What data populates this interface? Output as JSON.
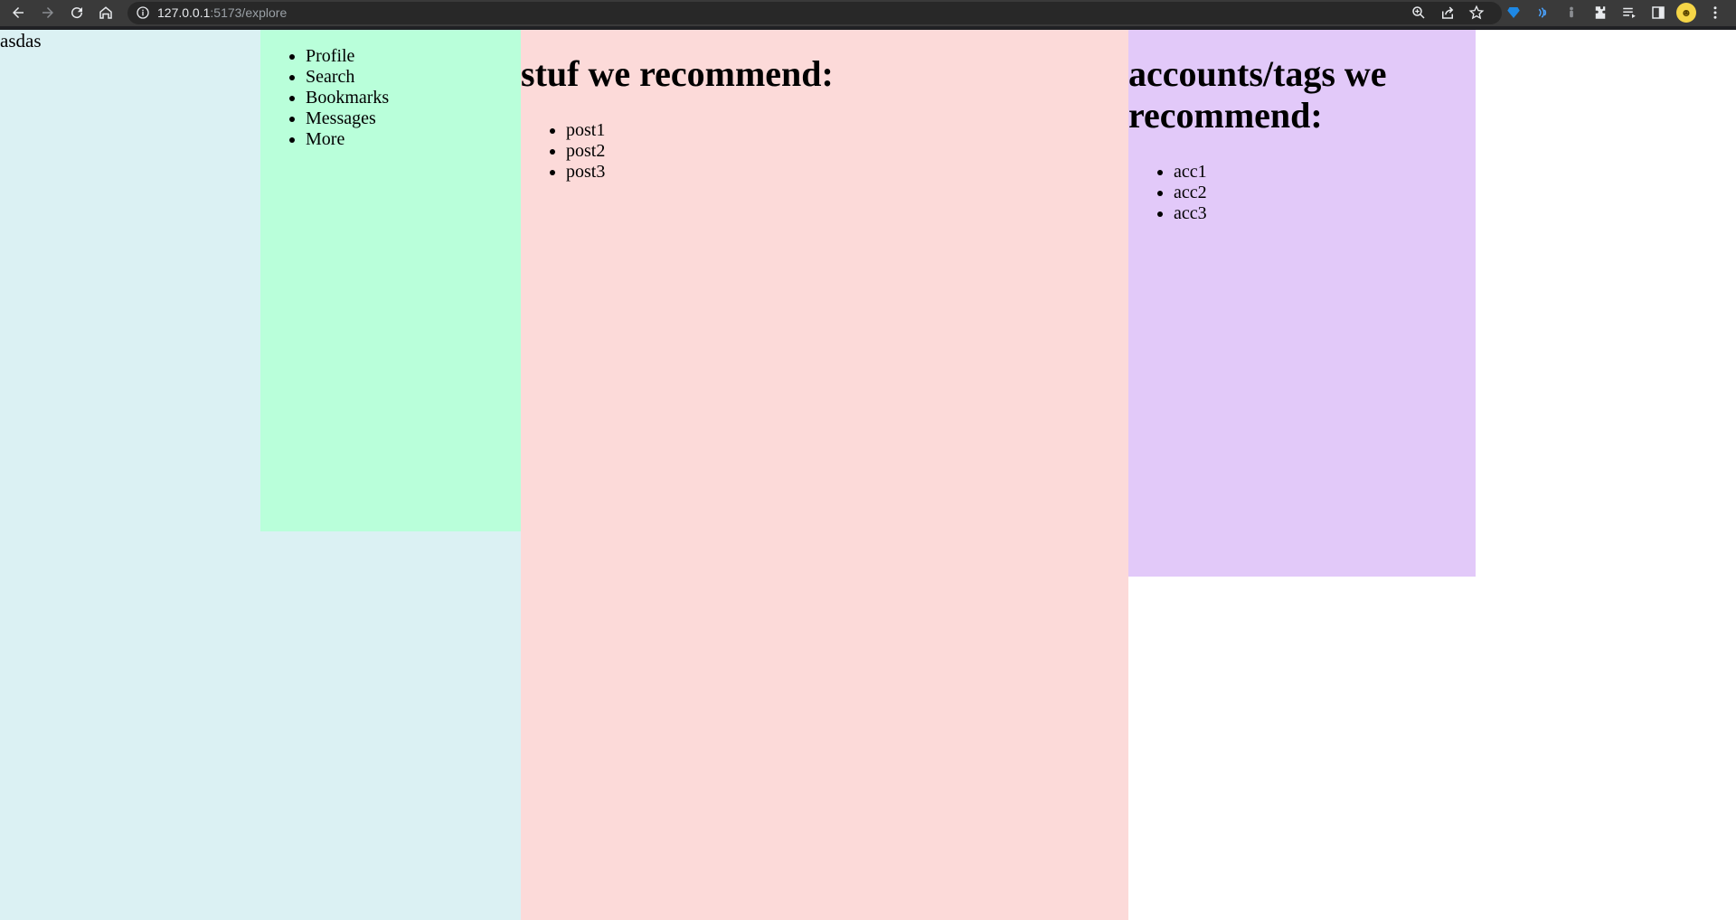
{
  "browser": {
    "url_host": "127.0.0.1",
    "url_rest": ":5173/explore",
    "icons": {
      "back": "arrow-left-icon",
      "forward": "arrow-right-icon",
      "reload": "reload-icon",
      "home": "home-icon",
      "info": "info-icon",
      "zoom": "zoom-icon",
      "share": "share-icon",
      "bookmark": "star-icon",
      "extensions": "puzzle-icon",
      "menu": "kebab-menu-icon"
    }
  },
  "page": {
    "brand": "asdas",
    "nav": {
      "items": [
        "Profile",
        "Search",
        "Bookmarks",
        "Messages",
        "More"
      ]
    },
    "feed": {
      "heading": "stuf we recommend:",
      "posts": [
        "post1",
        "post2",
        "post3"
      ]
    },
    "recommendations": {
      "heading": "accounts/tags we recommend:",
      "accounts": [
        "acc1",
        "acc2",
        "acc3"
      ]
    },
    "colors": {
      "left_column": "#dbf1f3",
      "nav": "#b9ffda",
      "feed": "#fcdad9",
      "recommendations": "#e2c9f9"
    }
  }
}
